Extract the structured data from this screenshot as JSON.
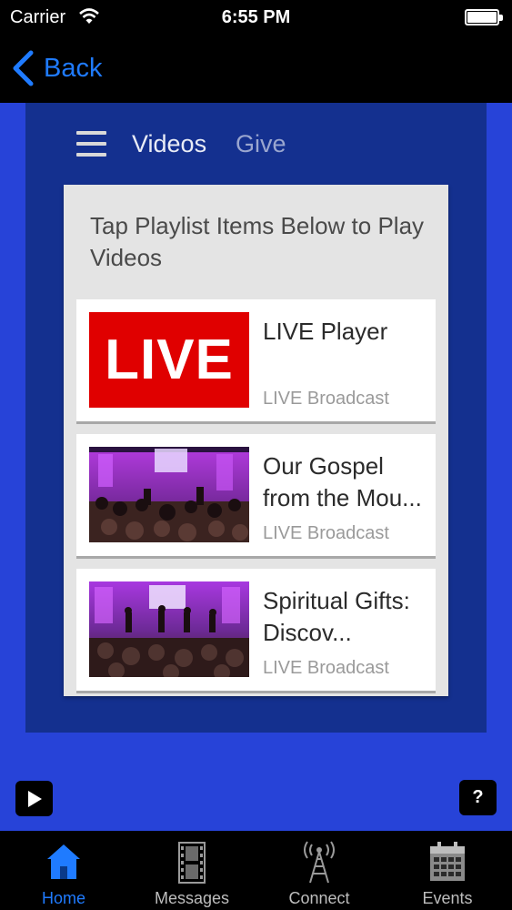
{
  "status_bar": {
    "carrier": "Carrier",
    "time": "6:55 PM"
  },
  "nav_bar": {
    "back_label": "Back"
  },
  "menu": {
    "items": [
      "Videos",
      "Give"
    ]
  },
  "playlist": {
    "heading": "Tap Playlist Items Below to Play Videos",
    "items": [
      {
        "title": "LIVE Player",
        "subtitle": "LIVE Broadcast",
        "thumb_text": "LIVE"
      },
      {
        "title_line1": "Our Gospel",
        "title_line2": "from the Mou...",
        "subtitle": "LIVE Broadcast"
      },
      {
        "title_line1": "Spiritual Gifts:",
        "title_line2": "Discov...",
        "subtitle": "LIVE Broadcast"
      }
    ]
  },
  "floating": {
    "help_label": "?"
  },
  "tab_bar": {
    "tabs": [
      {
        "label": "Home",
        "icon": "home-icon",
        "active": true
      },
      {
        "label": "Messages",
        "icon": "film-icon"
      },
      {
        "label": "Connect",
        "icon": "broadcast-tower-icon"
      },
      {
        "label": "Events",
        "icon": "calendar-icon"
      }
    ]
  },
  "colors": {
    "accent": "#1f7bff",
    "background": "#2743d8",
    "panel": "#14308f",
    "live_red": "#e00000"
  }
}
